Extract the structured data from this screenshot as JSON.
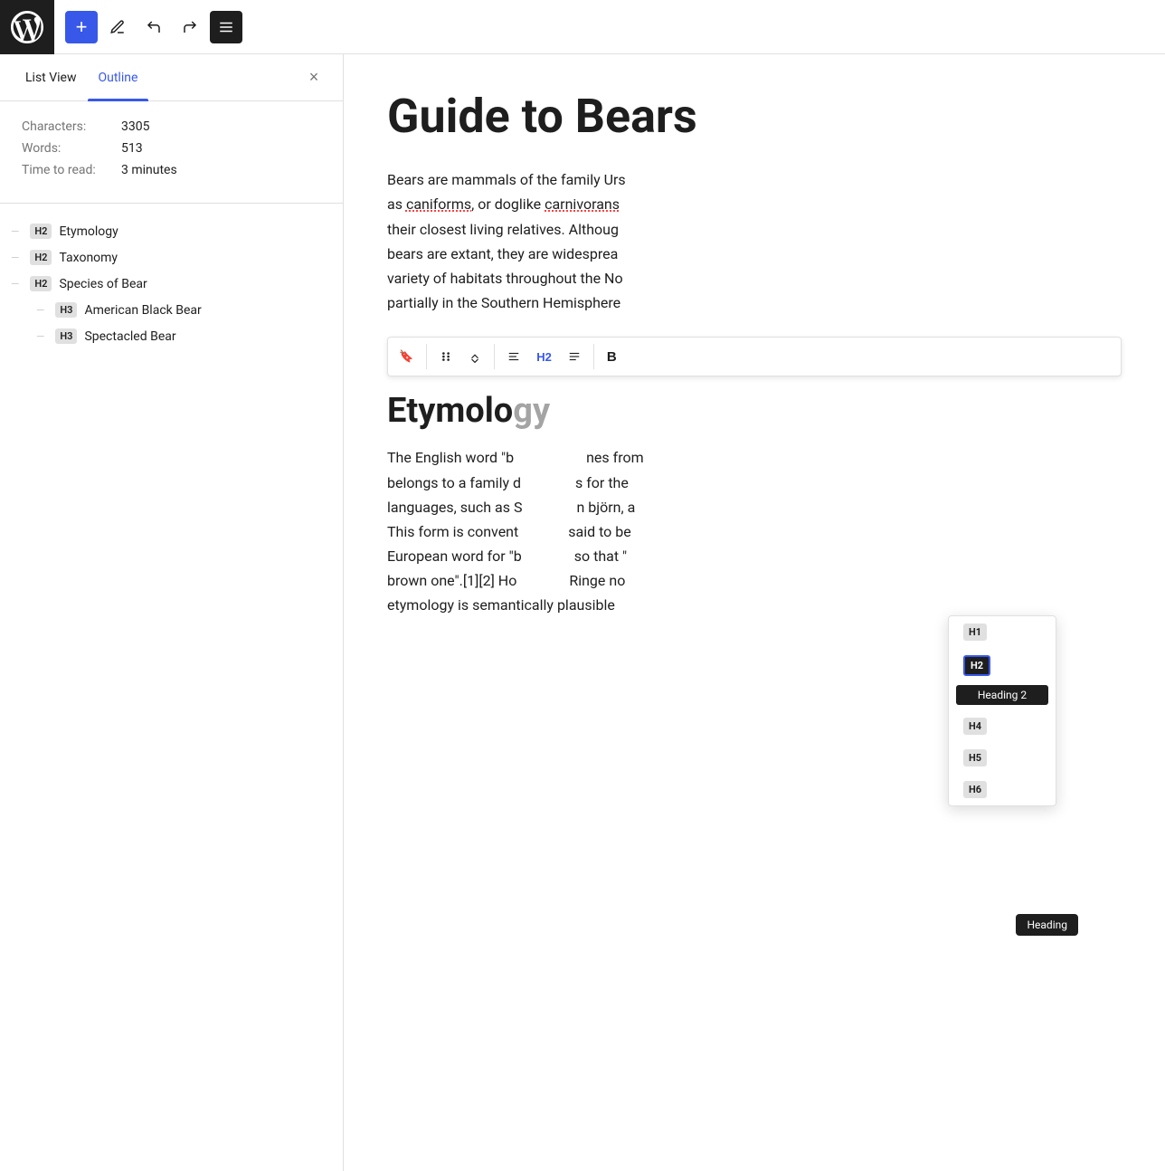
{
  "toolbar": {
    "add_label": "+",
    "undo_label": "↩",
    "redo_label": "↪",
    "menu_label": "☰"
  },
  "tabs": {
    "list_view": "List View",
    "outline": "Outline",
    "close": "×"
  },
  "stats": {
    "characters_label": "Characters:",
    "characters_value": "3305",
    "words_label": "Words:",
    "words_value": "513",
    "time_label": "Time to read:",
    "time_value": "3 minutes"
  },
  "outline_items": [
    {
      "level": "H2",
      "text": "Etymology",
      "indent": false
    },
    {
      "level": "H2",
      "text": "Taxonomy",
      "indent": false
    },
    {
      "level": "H2",
      "text": "Species of Bear",
      "indent": false
    },
    {
      "level": "H3",
      "text": "American Black Bear",
      "indent": true
    },
    {
      "level": "H3",
      "text": "Spectacled Bear",
      "indent": true
    }
  ],
  "content": {
    "title": "Guide to Bears",
    "intro": "Bears are mammals of the family Urs… as caniforms, or doglike carnivorans… their closest living relatives. Althoug bears are extant, they are widesprea variety of habitats throughout the No partially in the Southern Hemisphere",
    "intro_line1": "Bears are mammals of the family Urs",
    "intro_line2": "as ",
    "intro_caniforms": "caniforms",
    "intro_line2b": ", or doglike ",
    "intro_carnivorans": "carnivorans",
    "intro_line3": "their closest living relatives. Althoug",
    "intro_line4": "bears are extant, they are widesprea",
    "intro_line5": "variety of habitats throughout the No",
    "intro_line6": "partially in the Southern Hemisphere",
    "etymology_heading": "Etymology",
    "etymology_text1": "The English word \"b",
    "etymology_text2": "nes from",
    "etymology_text3": "belongs to a family d",
    "etymology_text4": "s for the",
    "etymology_text5": "languages, such as S",
    "etymology_text6": "n björn, a",
    "etymology_text7": "This form is convent",
    "etymology_text8": "said to be",
    "etymology_text9": "European word for \"b",
    "etymology_text10": "so that \"",
    "etymology_text11": "brown one\".[1][2] Ho",
    "etymology_text12": "Ringe no",
    "etymology_text13": "etymology is semantically plausible",
    "heading_label": "Heading"
  },
  "block_toolbar": {
    "bookmark": "🔖",
    "drag": "⠿",
    "move_up_down": "⌃",
    "align": "≡",
    "h2": "H2",
    "text_align": "≡",
    "bold": "B"
  },
  "heading_picker": {
    "items": [
      {
        "label": "H1",
        "selected": false
      },
      {
        "label": "H2",
        "selected": true
      },
      {
        "tooltip": "Heading 2"
      },
      {
        "label": "H4",
        "selected": false
      },
      {
        "label": "H5",
        "selected": false
      },
      {
        "label": "H6",
        "selected": false
      }
    ]
  },
  "heading_tooltip": "Heading"
}
